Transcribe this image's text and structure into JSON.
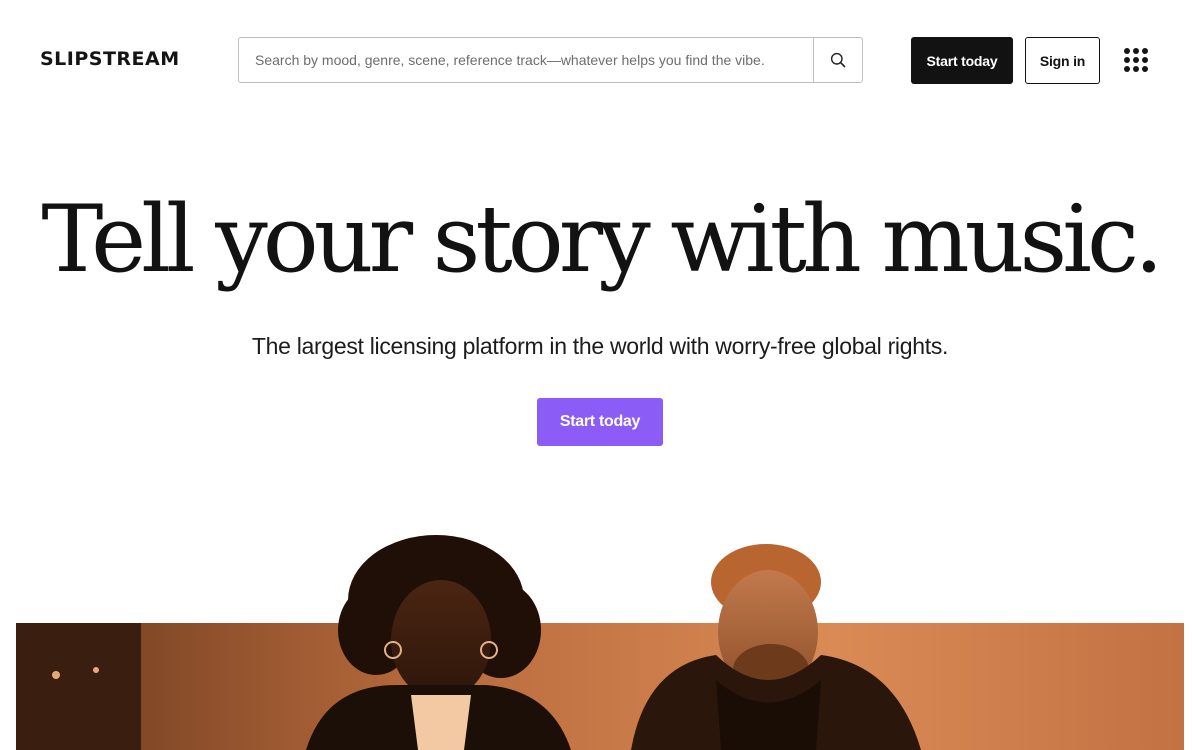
{
  "header": {
    "logo": "SLIPSTREAM",
    "search_placeholder": "Search by mood, genre, scene, reference track—whatever helps you find the vibe.",
    "start_label": "Start today",
    "signin_label": "Sign in"
  },
  "hero": {
    "title": "Tell your story with music.",
    "subtitle": "The largest licensing platform in the world with worry-free global rights.",
    "cta_label": "Start today"
  },
  "colors": {
    "accent": "#8b5cf6",
    "dark": "#121212",
    "photo_tint": "#c8784a"
  },
  "icons": {
    "search": "search-icon",
    "menu": "grid-menu-icon"
  }
}
